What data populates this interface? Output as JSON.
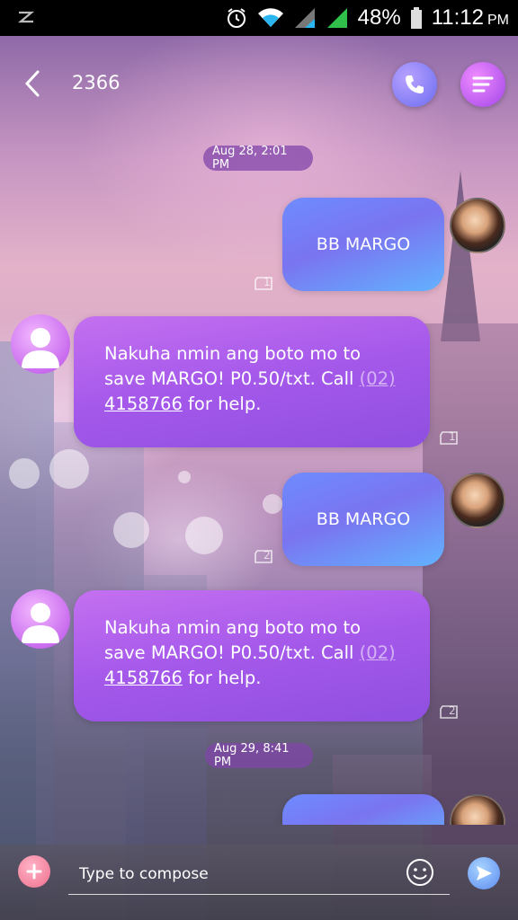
{
  "status_bar": {
    "notification_icon": "z-notification-icon",
    "battery_percent": "48%",
    "time": "11:12",
    "ampm": "PM",
    "icons": [
      "alarm-icon",
      "wifi-icon",
      "signal-icon",
      "signal-icon",
      "battery-icon"
    ]
  },
  "header": {
    "title": "2366",
    "back_icon": "chevron-left-icon",
    "call_icon": "phone-icon",
    "menu_icon": "menu-lines-icon"
  },
  "conversation": {
    "date_1": "Aug 28, 2:01 PM",
    "date_2": "Aug 29, 8:41 PM",
    "sent_1": {
      "text": "BB MARGO",
      "marker": "1"
    },
    "received_1": {
      "text_a": "Nakuha nmin ang boto mo to save MARGO! P0.50/txt. Call ",
      "link_a": "(02)",
      "link_b": "4158766",
      "text_b": " for help.",
      "marker": "1"
    },
    "sent_2": {
      "text": "BB MARGO",
      "marker": "2"
    },
    "received_2": {
      "text_a": "Nakuha nmin ang boto mo to save MARGO! P0.50/txt. Call ",
      "link_a": "(02)",
      "link_b": "4158766",
      "text_b": " for help.",
      "marker": "2"
    }
  },
  "compose": {
    "placeholder": "Type to compose",
    "add_icon": "plus-icon",
    "emoji_icon": "smiley-icon",
    "send_icon": "send-arrow-icon"
  },
  "colors": {
    "sent_bubble": "#6e8cff",
    "received_bubble": "#a458ea",
    "call_button": "#6a6cf0",
    "menu_button": "#a146e8",
    "add_button": "#ef6e8d",
    "send_button": "#5b8bf0"
  }
}
